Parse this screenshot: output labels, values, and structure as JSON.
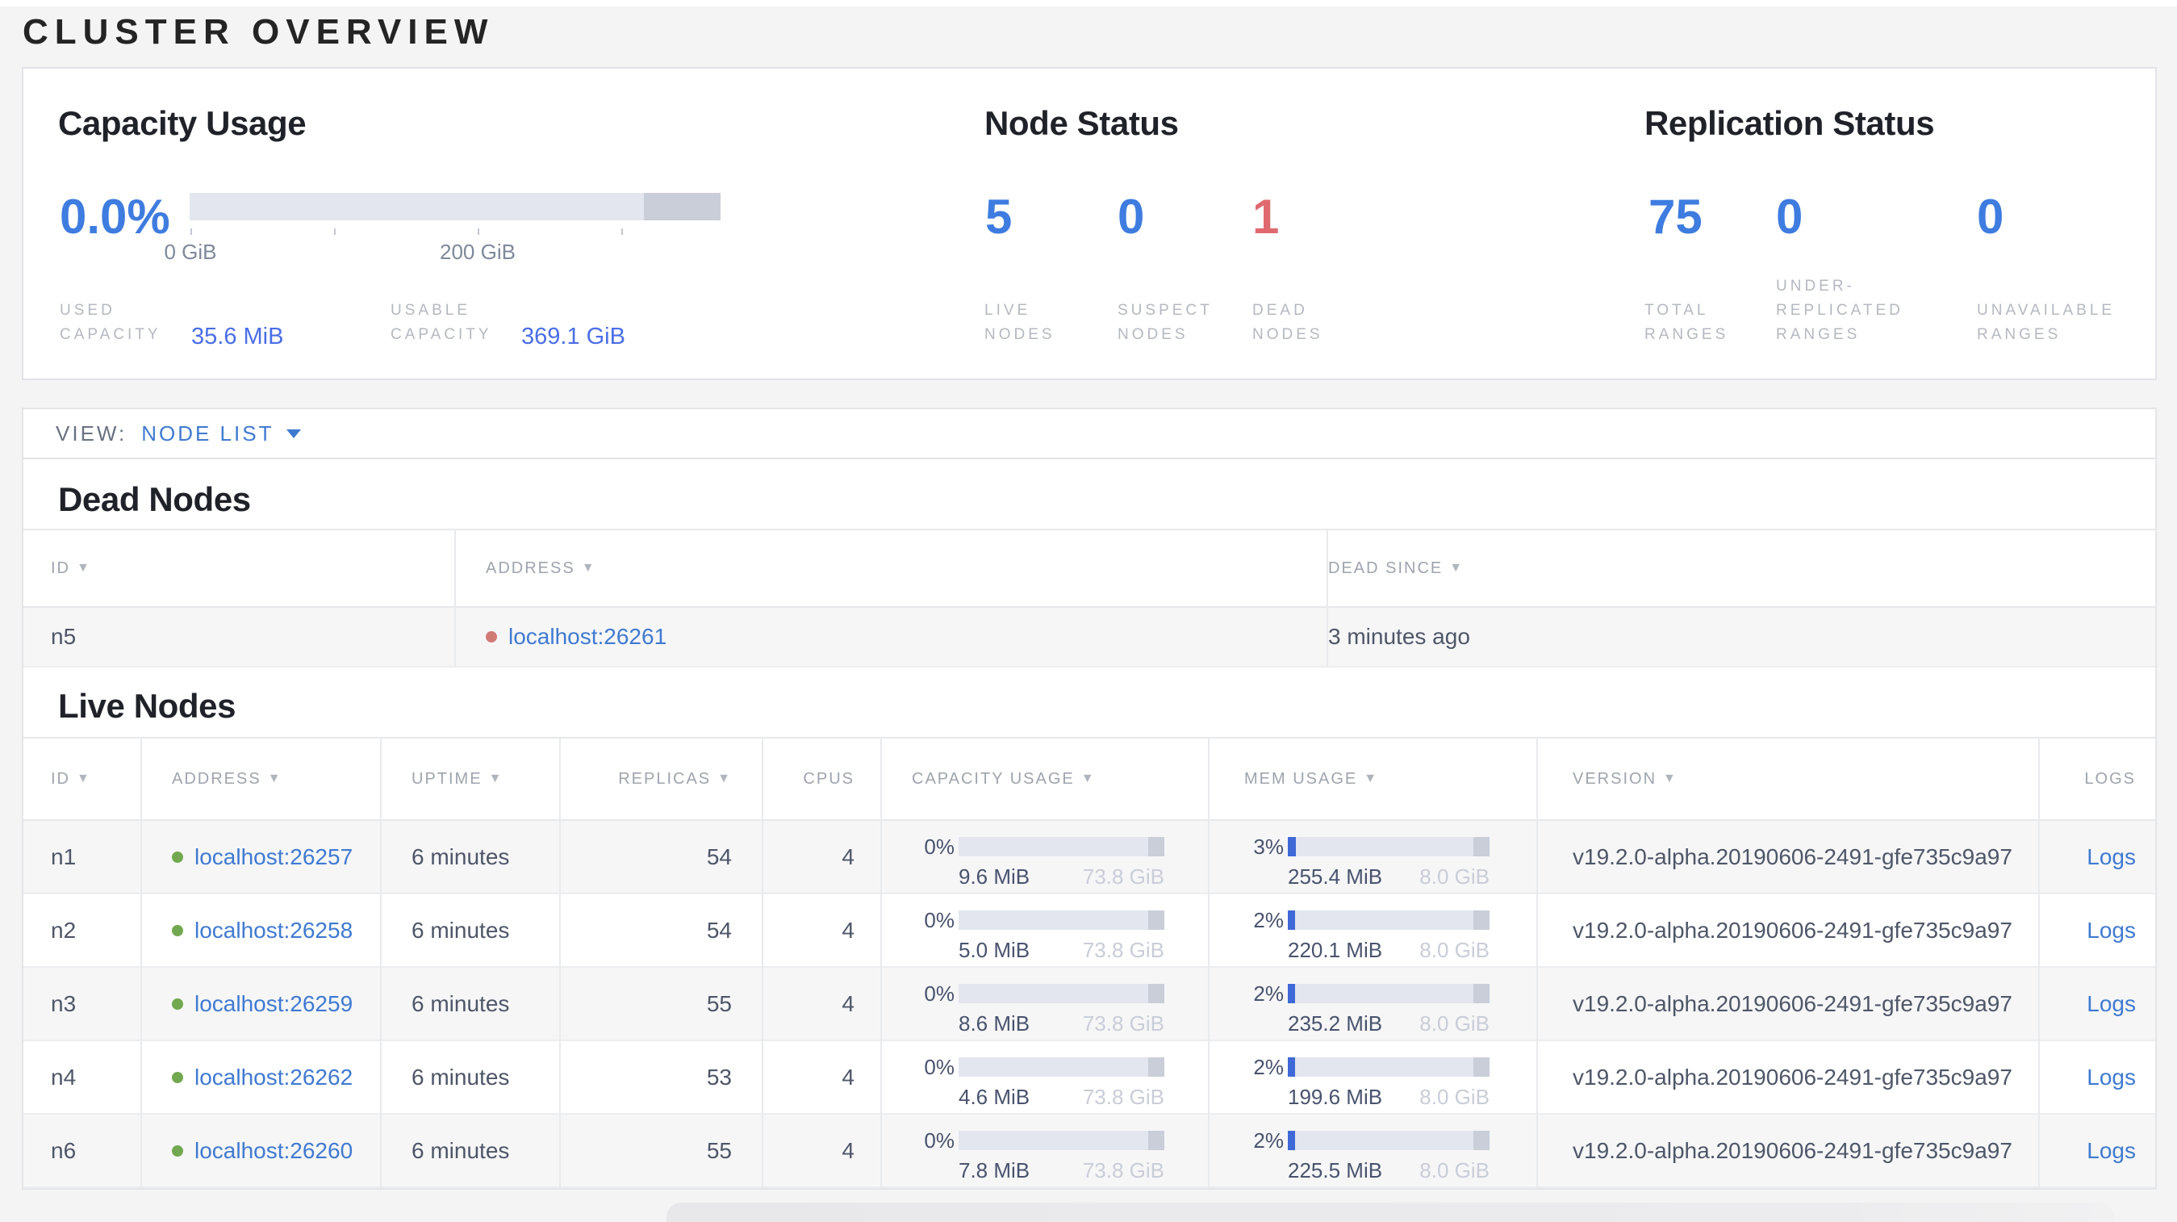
{
  "page_title": "CLUSTER OVERVIEW",
  "summary": {
    "capacity": {
      "title": "Capacity Usage",
      "percent": "0.0%",
      "axis_ticks": [
        "0 GiB",
        "",
        "200 GiB",
        ""
      ],
      "stats": [
        {
          "label_line1": "USED",
          "label_line2": "CAPACITY",
          "value": "35.6 MiB"
        },
        {
          "label_line1": "USABLE",
          "label_line2": "CAPACITY",
          "value": "369.1 GiB"
        }
      ]
    },
    "node_status": {
      "title": "Node Status",
      "stats": [
        {
          "value": "5",
          "label": "LIVE NODES"
        },
        {
          "value": "0",
          "label": "SUSPECT NODES"
        },
        {
          "value": "1",
          "label": "DEAD NODES",
          "state": "dead"
        }
      ]
    },
    "replication_status": {
      "title": "Replication Status",
      "stats": [
        {
          "value": "75",
          "label": "TOTAL RANGES"
        },
        {
          "value": "0",
          "label": "UNDER-REPLICATED RANGES"
        },
        {
          "value": "0",
          "label": "UNAVAILABLE RANGES"
        }
      ]
    }
  },
  "view_bar": {
    "label": "VIEW:",
    "selected": "NODE LIST"
  },
  "dead_nodes": {
    "title": "Dead Nodes",
    "columns": [
      "ID",
      "ADDRESS",
      "DEAD SINCE"
    ],
    "rows": [
      {
        "id": "n5",
        "address": "localhost:26261",
        "dead_since": "3 minutes ago"
      }
    ]
  },
  "live_nodes": {
    "title": "Live Nodes",
    "columns": [
      "ID",
      "ADDRESS",
      "UPTIME",
      "REPLICAS",
      "CPUS",
      "CAPACITY USAGE",
      "MEM USAGE",
      "VERSION",
      "LOGS"
    ],
    "rows": [
      {
        "id": "n1",
        "address": "localhost:26257",
        "uptime": "6 minutes",
        "replicas": "54",
        "cpus": "4",
        "capacity": {
          "pct": "0%",
          "pct_num": 0,
          "used": "9.6 MiB",
          "total": "73.8 GiB"
        },
        "mem": {
          "pct": "3%",
          "pct_num": 3,
          "used": "255.4 MiB",
          "total": "8.0 GiB"
        },
        "version": "v19.2.0-alpha.20190606-2491-gfe735c9a97",
        "logs": "Logs"
      },
      {
        "id": "n2",
        "address": "localhost:26258",
        "uptime": "6 minutes",
        "replicas": "54",
        "cpus": "4",
        "capacity": {
          "pct": "0%",
          "pct_num": 0,
          "used": "5.0 MiB",
          "total": "73.8 GiB"
        },
        "mem": {
          "pct": "2%",
          "pct_num": 2,
          "used": "220.1 MiB",
          "total": "8.0 GiB"
        },
        "version": "v19.2.0-alpha.20190606-2491-gfe735c9a97",
        "logs": "Logs"
      },
      {
        "id": "n3",
        "address": "localhost:26259",
        "uptime": "6 minutes",
        "replicas": "55",
        "cpus": "4",
        "capacity": {
          "pct": "0%",
          "pct_num": 0,
          "used": "8.6 MiB",
          "total": "73.8 GiB"
        },
        "mem": {
          "pct": "2%",
          "pct_num": 2,
          "used": "235.2 MiB",
          "total": "8.0 GiB"
        },
        "version": "v19.2.0-alpha.20190606-2491-gfe735c9a97",
        "logs": "Logs"
      },
      {
        "id": "n4",
        "address": "localhost:26262",
        "uptime": "6 minutes",
        "replicas": "53",
        "cpus": "4",
        "capacity": {
          "pct": "0%",
          "pct_num": 0,
          "used": "4.6 MiB",
          "total": "73.8 GiB"
        },
        "mem": {
          "pct": "2%",
          "pct_num": 2,
          "used": "199.6 MiB",
          "total": "8.0 GiB"
        },
        "version": "v19.2.0-alpha.20190606-2491-gfe735c9a97",
        "logs": "Logs"
      },
      {
        "id": "n6",
        "address": "localhost:26260",
        "uptime": "6 minutes",
        "replicas": "55",
        "cpus": "4",
        "capacity": {
          "pct": "0%",
          "pct_num": 0,
          "used": "7.8 MiB",
          "total": "73.8 GiB"
        },
        "mem": {
          "pct": "2%",
          "pct_num": 2,
          "used": "225.5 MiB",
          "total": "8.0 GiB"
        },
        "version": "v19.2.0-alpha.20190606-2491-gfe735c9a97",
        "logs": "Logs"
      }
    ]
  },
  "colors": {
    "accent_blue": "#3e7ce0",
    "link_blue": "#3f7ad1",
    "value_blue": "#4a6ee6",
    "dead_red": "#e0696f",
    "live_green": "#72a84f",
    "mem_fill": "#3f69d6"
  }
}
